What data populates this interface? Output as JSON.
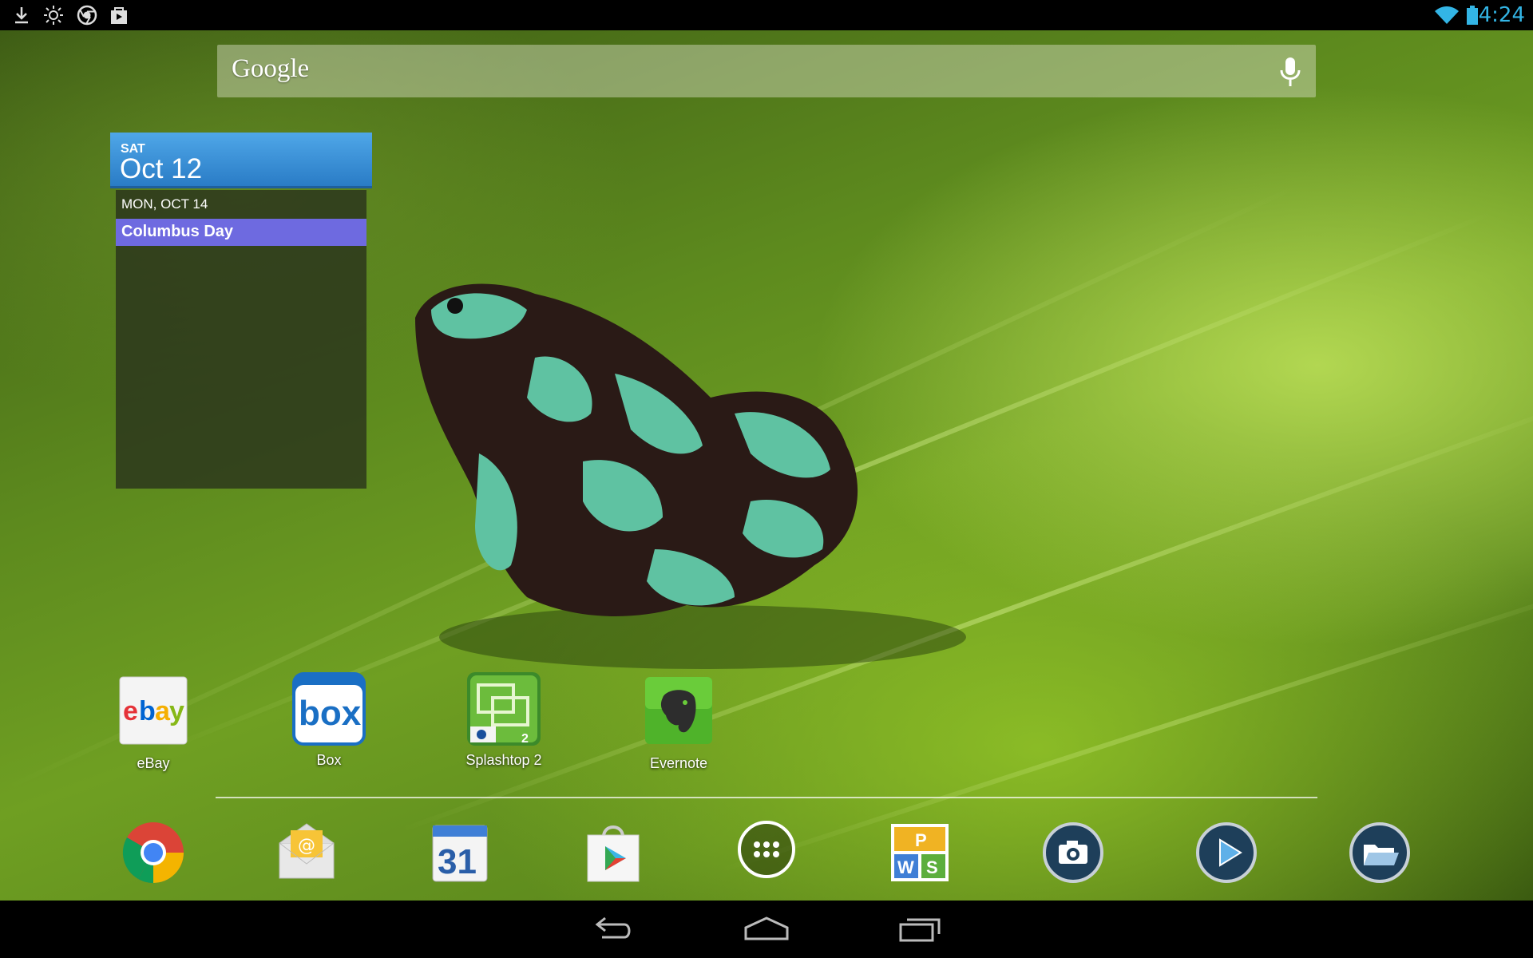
{
  "status_bar": {
    "notification_icons": [
      "download-icon",
      "brightness-icon",
      "chrome-icon",
      "play-store-bag-icon"
    ],
    "clock": "4:24",
    "accent_color": "#33b5e5"
  },
  "search": {
    "label": "Google",
    "mic_icon": "microphone-icon"
  },
  "calendar_widget": {
    "day": "SAT",
    "date": "Oct 12",
    "upcoming_date": "MON, OCT 14",
    "event": "Columbus Day",
    "header_color": "#3a8fd8",
    "event_color": "#6e6ae0"
  },
  "apps": [
    {
      "label": "eBay",
      "icon": "ebay-icon"
    },
    {
      "label": "Box",
      "icon": "box-icon"
    },
    {
      "label": "Splashtop 2",
      "icon": "splashtop-icon"
    },
    {
      "label": "Evernote",
      "icon": "evernote-icon"
    }
  ],
  "dock": [
    {
      "icon": "chrome-icon"
    },
    {
      "icon": "email-icon"
    },
    {
      "icon": "calendar-icon",
      "text": "31"
    },
    {
      "icon": "play-store-icon"
    },
    {
      "icon": "app-drawer-icon"
    },
    {
      "icon": "office-suite-icon",
      "letters": [
        "P",
        "W",
        "S"
      ]
    },
    {
      "icon": "camera-icon"
    },
    {
      "icon": "media-player-icon"
    },
    {
      "icon": "file-manager-icon"
    }
  ],
  "nav_bar": [
    "back-icon",
    "home-icon",
    "recent-apps-icon"
  ]
}
